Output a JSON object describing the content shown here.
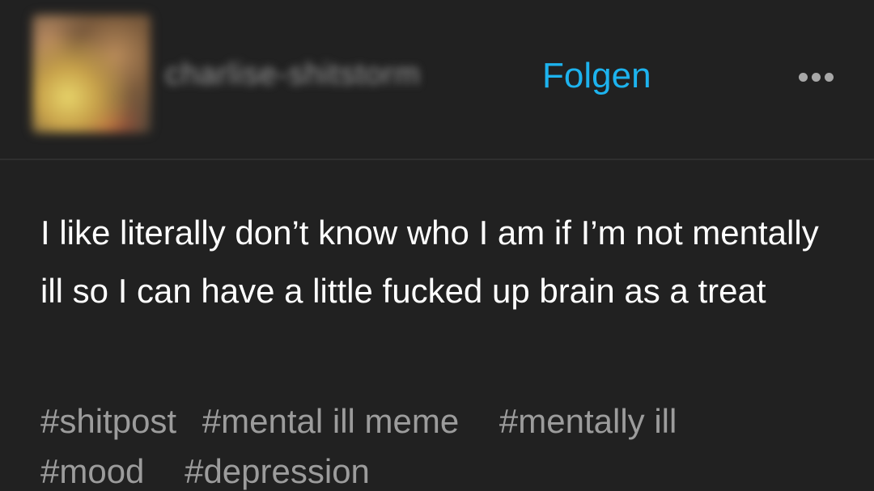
{
  "header": {
    "username": "charlise-shitstorm",
    "follow_label": "Folgen",
    "more_icon": "more-horizontal-icon"
  },
  "post": {
    "text": "I like literally don’t know who I am if I’m not mentally ill so I can have a little fucked up brain as a treat"
  },
  "tags": [
    "#shitpost",
    "#mental ill meme",
    "#mentally ill",
    "#mood",
    "#depression"
  ],
  "colors": {
    "background": "#212121",
    "accent": "#1db3ee",
    "tag_text": "#9c9c9c",
    "body_text": "#ffffff"
  }
}
